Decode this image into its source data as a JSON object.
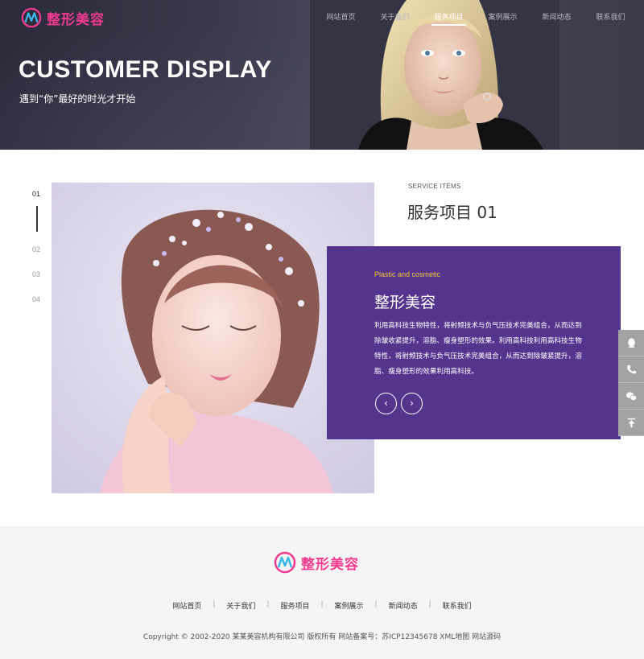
{
  "brand": {
    "name": "整形美容",
    "color": "#f13a8f"
  },
  "nav": {
    "items": [
      "网站首页",
      "关于我们",
      "服务项目",
      "案例展示",
      "新闻动态",
      "联系我们"
    ],
    "active": "服务项目"
  },
  "hero": {
    "title": "CUSTOMER DISPLAY",
    "subtitle": "遇到“你”最好的时光才开始"
  },
  "slider": {
    "pages": [
      "01",
      "02",
      "03",
      "04"
    ],
    "active_page": "01",
    "kicker": "SERVICE ITEMS",
    "title": "服务项目 01",
    "card": {
      "kicker": "Plastic and cosmetic",
      "title": "整形美容",
      "body": "利用高科技生物特性，将射频技术与负气压技术完美组合，从而达到除皱收紧提升，溶脂、瘦身塑形的效果。利用高科技利用高科技生物特性，将射频技术与负气压技术完美组合，从而达到除皱紧提升，溶脂、瘦身塑形的效果利用高科技。",
      "prev_icon": "chevron-left-icon",
      "next_icon": "chevron-right-icon",
      "prev_glyph": "‹",
      "next_glyph": "›",
      "color": "#55348d",
      "kicker_color": "#f3c93a"
    }
  },
  "side_toolbar": [
    "qq-icon",
    "phone-icon",
    "wechat-icon",
    "back-to-top-icon"
  ],
  "footer": {
    "links": [
      "网站首页",
      "关于我们",
      "服务项目",
      "案例展示",
      "新闻动态",
      "联系我们"
    ],
    "separator": "|",
    "copyright": "Copyright © 2002-2020 某某美容机构有限公司 版权所有 网站备案号：苏ICP12345678 XML地图 网站源码"
  }
}
